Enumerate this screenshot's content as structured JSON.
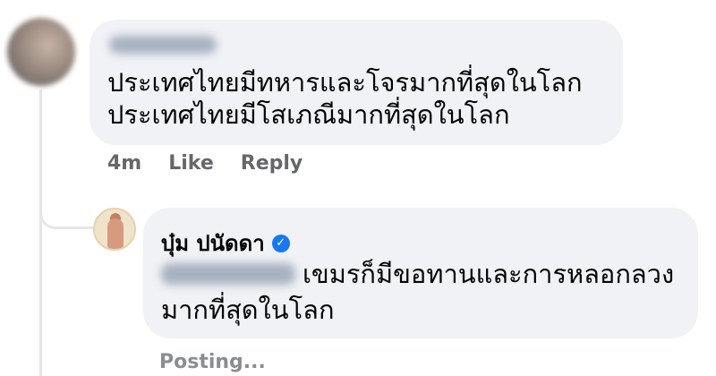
{
  "comment1": {
    "lines": [
      "ประเทศไทยมีทหารและโจรมากที่สุดในโลก",
      "ประเทศไทยมีโสเภณีมากที่สุดในโลก"
    ],
    "time": "4m",
    "like": "Like",
    "reply": "Reply"
  },
  "reply1": {
    "author": "บุ๋ม ปนัดดา",
    "lines": [
      "เขมรก็มีขอทานและการหลอกลวง",
      "มากที่สุดในโลก"
    ],
    "status": "Posting..."
  },
  "colors": {
    "bubble": "#f0f2f5",
    "meta_text": "#65676b",
    "verified": "#1877f2"
  },
  "icons": [
    "verified-badge-icon"
  ]
}
